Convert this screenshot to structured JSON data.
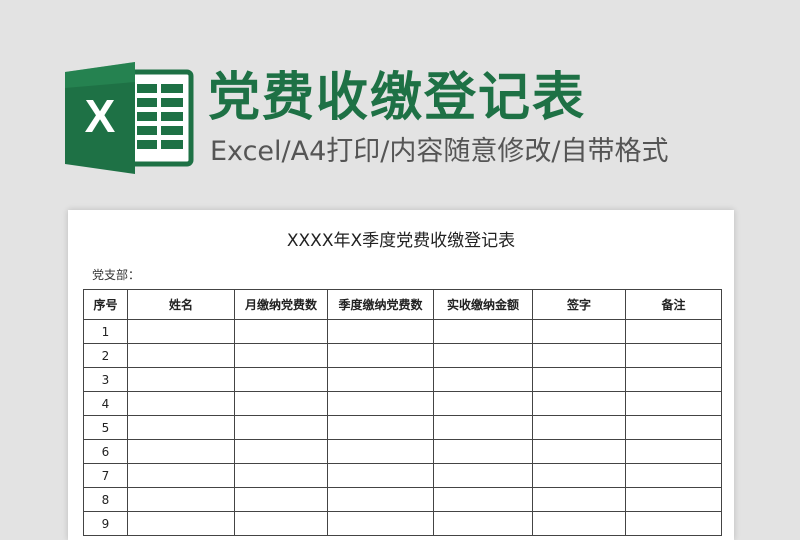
{
  "header": {
    "title": "党费收缴登记表",
    "subtitle": "Excel/A4打印/内容随意修改/自带格式"
  },
  "logo": {
    "icon": "excel-icon",
    "letter": "X",
    "colors": {
      "dark": "#185c37",
      "main": "#1e7145",
      "light": "#33a265"
    }
  },
  "sheet": {
    "title": "XXXX年X季度党费收缴登记表",
    "branch_label": "党支部：",
    "columns": [
      "序号",
      "姓名",
      "月缴纳党费数",
      "季度缴纳党费数",
      "实收缴纳金额",
      "签字",
      "备注"
    ],
    "rows": [
      "1",
      "2",
      "3",
      "4",
      "5",
      "6",
      "7",
      "8",
      "9"
    ]
  }
}
